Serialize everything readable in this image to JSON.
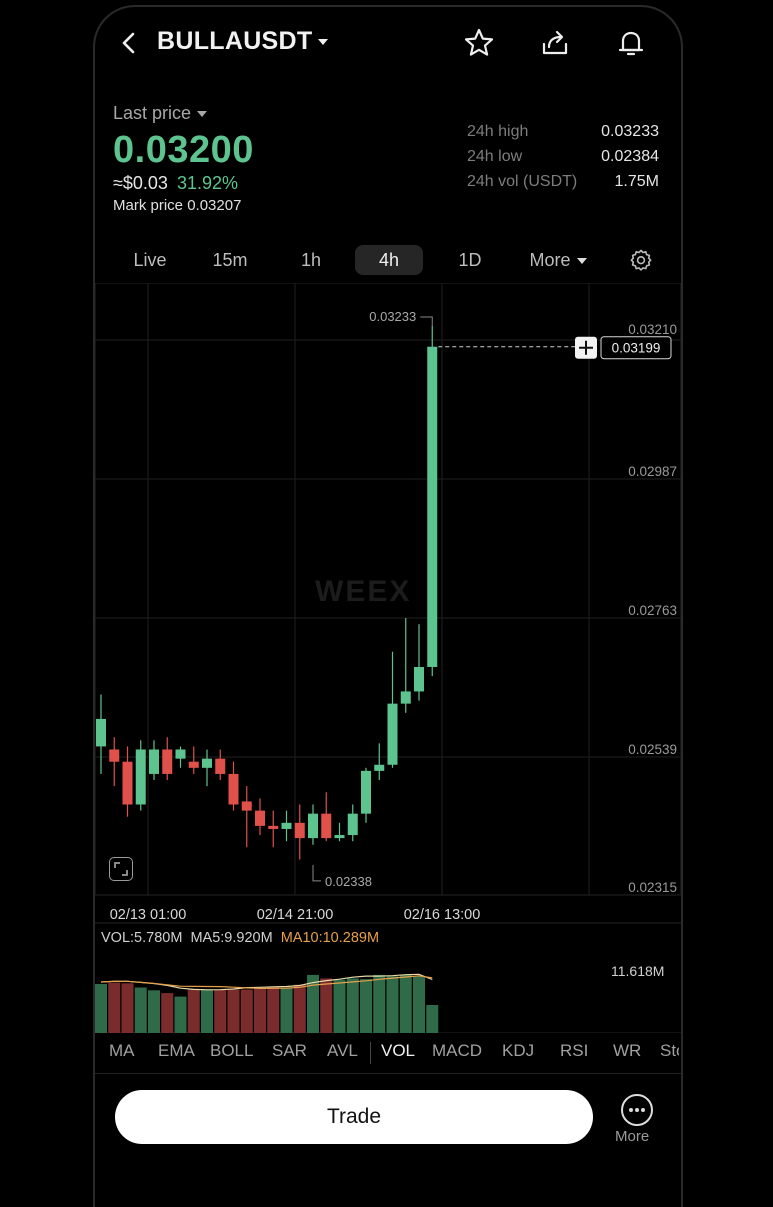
{
  "header": {
    "pair": "BULLAUSDT",
    "icons": [
      "back-icon",
      "star-icon",
      "share-icon",
      "bell-icon"
    ]
  },
  "ticker": {
    "last_price_label": "Last price",
    "last_price": "0.03200",
    "usd_value": "≈$0.03",
    "change_pct": "31.92%",
    "mark_label": "Mark price",
    "mark_price": "0.03207",
    "stats": [
      {
        "label": "24h high",
        "value": "0.03233"
      },
      {
        "label": "24h low",
        "value": "0.02384"
      },
      {
        "label": "24h vol (USDT)",
        "value": "1.75M"
      }
    ]
  },
  "timeframes": {
    "items": [
      "Live",
      "15m",
      "1h",
      "4h",
      "1D"
    ],
    "active": "4h",
    "more_label": "More"
  },
  "chart": {
    "watermark": "WEEX",
    "high_label": "0.03233",
    "low_label": "0.02338",
    "current_label": "0.03199",
    "y_ticks": [
      "0.03210",
      "0.02987",
      "0.02763",
      "0.02539",
      "0.02315"
    ],
    "x_ticks": [
      "02/13 01:00",
      "02/14 21:00",
      "02/16 13:00"
    ]
  },
  "volume": {
    "vol_label": "VOL:5.780M",
    "ma5_label": "MA5:9.920M",
    "ma10_label": "MA10:10.289M",
    "max_label": "11.618M"
  },
  "indicators": {
    "items": [
      "MA",
      "EMA",
      "BOLL",
      "SAR",
      "AVL",
      "VOL",
      "MACD",
      "KDJ",
      "RSI",
      "WR",
      "Sto"
    ],
    "active": "VOL"
  },
  "footer": {
    "trade_label": "Trade",
    "more_label": "More"
  },
  "colors": {
    "up": "#5ec48f",
    "down": "#e0514c",
    "ma5": "#e9d9a8",
    "ma10": "#e6a04a"
  },
  "chart_data": {
    "type": "candlestick",
    "x_ticks": [
      "02/13 01:00",
      "02/14 21:00",
      "02/16 13:00"
    ],
    "ylim": [
      0.02315,
      0.0321
    ],
    "y_ticks": [
      0.0321,
      0.02987,
      0.02763,
      0.02539,
      0.02315
    ],
    "candles": [
      {
        "o": 0.02545,
        "h": 0.0263,
        "l": 0.025,
        "c": 0.0259
      },
      {
        "o": 0.0254,
        "h": 0.0256,
        "l": 0.0248,
        "c": 0.0252
      },
      {
        "o": 0.0252,
        "h": 0.02545,
        "l": 0.0243,
        "c": 0.0245
      },
      {
        "o": 0.0245,
        "h": 0.02555,
        "l": 0.0244,
        "c": 0.0254
      },
      {
        "o": 0.025,
        "h": 0.02555,
        "l": 0.0249,
        "c": 0.0254
      },
      {
        "o": 0.0254,
        "h": 0.0256,
        "l": 0.0249,
        "c": 0.025
      },
      {
        "o": 0.02525,
        "h": 0.02545,
        "l": 0.0251,
        "c": 0.0254
      },
      {
        "o": 0.0252,
        "h": 0.02545,
        "l": 0.025,
        "c": 0.0251
      },
      {
        "o": 0.0251,
        "h": 0.0254,
        "l": 0.0248,
        "c": 0.02525
      },
      {
        "o": 0.02525,
        "h": 0.0254,
        "l": 0.0249,
        "c": 0.025
      },
      {
        "o": 0.025,
        "h": 0.0252,
        "l": 0.0244,
        "c": 0.0245
      },
      {
        "o": 0.02455,
        "h": 0.0248,
        "l": 0.0238,
        "c": 0.0244
      },
      {
        "o": 0.0244,
        "h": 0.0246,
        "l": 0.024,
        "c": 0.02415
      },
      {
        "o": 0.02415,
        "h": 0.0244,
        "l": 0.0238,
        "c": 0.0241
      },
      {
        "o": 0.0241,
        "h": 0.0244,
        "l": 0.0239,
        "c": 0.0242
      },
      {
        "o": 0.0242,
        "h": 0.0245,
        "l": 0.0236,
        "c": 0.02395
      },
      {
        "o": 0.02395,
        "h": 0.0245,
        "l": 0.02384,
        "c": 0.02435
      },
      {
        "o": 0.02435,
        "h": 0.0247,
        "l": 0.0239,
        "c": 0.02395
      },
      {
        "o": 0.02395,
        "h": 0.0242,
        "l": 0.0239,
        "c": 0.024
      },
      {
        "o": 0.024,
        "h": 0.0245,
        "l": 0.0239,
        "c": 0.02435
      },
      {
        "o": 0.02435,
        "h": 0.0251,
        "l": 0.0242,
        "c": 0.02505
      },
      {
        "o": 0.02505,
        "h": 0.0255,
        "l": 0.0249,
        "c": 0.02515
      },
      {
        "o": 0.02515,
        "h": 0.027,
        "l": 0.0251,
        "c": 0.02615
      },
      {
        "o": 0.02615,
        "h": 0.02755,
        "l": 0.026,
        "c": 0.02635
      },
      {
        "o": 0.02635,
        "h": 0.02745,
        "l": 0.0262,
        "c": 0.02675
      },
      {
        "o": 0.02675,
        "h": 0.03233,
        "l": 0.0266,
        "c": 0.03199
      }
    ],
    "volume": [
      0.7,
      0.72,
      0.71,
      0.65,
      0.61,
      0.57,
      0.52,
      0.62,
      0.62,
      0.62,
      0.62,
      0.62,
      0.64,
      0.66,
      0.64,
      0.69,
      0.83,
      0.78,
      0.76,
      0.78,
      0.77,
      0.83,
      0.81,
      0.83,
      0.81,
      0.4
    ]
  }
}
